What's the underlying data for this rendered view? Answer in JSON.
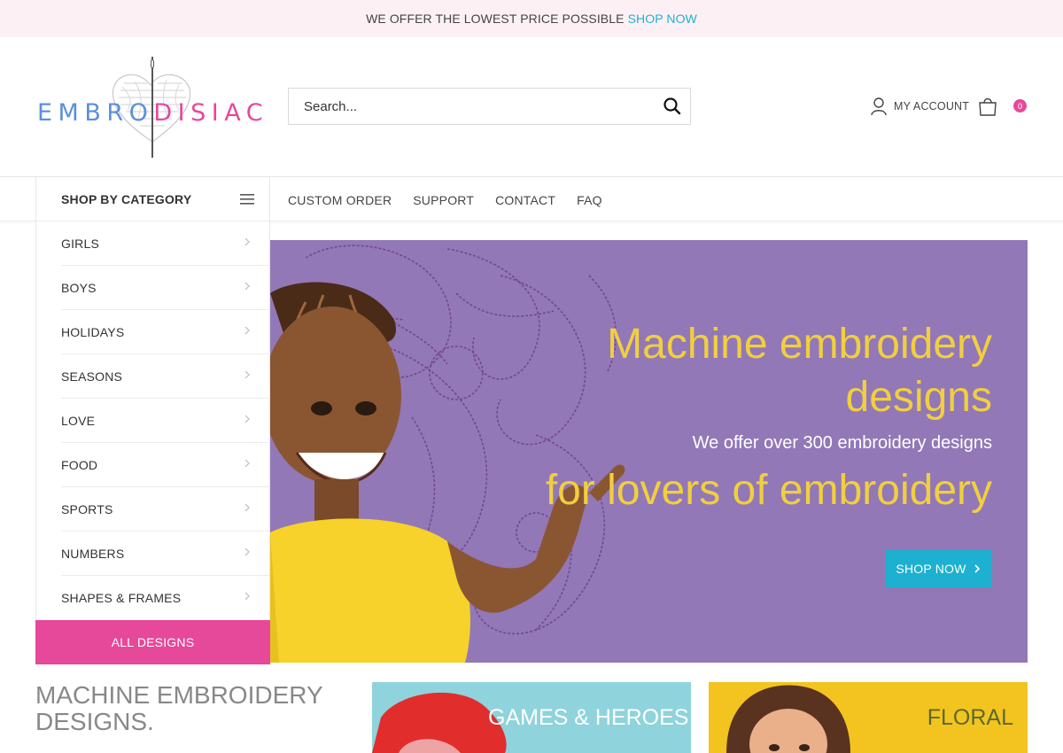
{
  "topbar": {
    "text": "WE OFFER THE LOWEST PRICE POSSIBLE",
    "link": "SHOP NOW"
  },
  "header": {
    "logo": {
      "part1": "EMBRO",
      "part2": "DISIAC"
    },
    "search": {
      "placeholder": "Search..."
    },
    "account_label": "MY ACCOUNT",
    "cart_count": "0"
  },
  "nav": {
    "category_title": "SHOP BY CATEGORY",
    "links": [
      "CUSTOM ORDER",
      "SUPPORT",
      "CONTACT",
      "FAQ"
    ]
  },
  "categories": [
    "GIRLS",
    "BOYS",
    "HOLIDAYS",
    "SEASONS",
    "LOVE",
    "FOOD",
    "SPORTS",
    "NUMBERS",
    "SHAPES & FRAMES"
  ],
  "all_designs": "ALL DESIGNS",
  "hero": {
    "title_line1": "Machine embroidery",
    "title_line2": "designs",
    "subtitle": "We offer over 300 embroidery designs",
    "tagline": "for lovers of embroidery",
    "cta": "SHOP NOW"
  },
  "section": {
    "title_line1": "MACHINE EMBROIDERY",
    "title_line2": "DESIGNS."
  },
  "promos": {
    "games": "GAMES & HEROES",
    "floral": "FLORAL"
  },
  "colors": {
    "accent_pink": "#e6489a",
    "accent_cyan": "#1eb0d0",
    "hero_bg": "#9278b7",
    "hero_text": "#f1cf3e"
  }
}
